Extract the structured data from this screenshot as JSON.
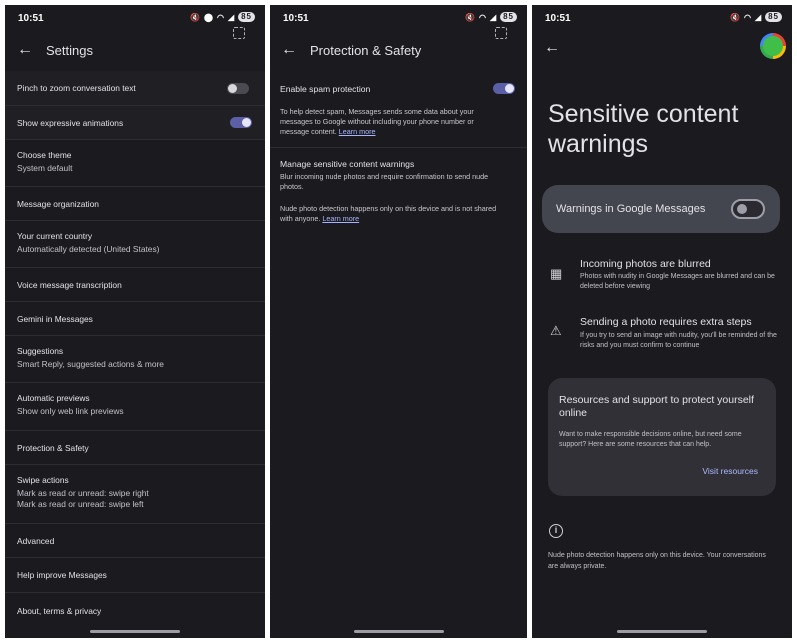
{
  "status": {
    "time": "10:51",
    "battery": "85"
  },
  "settings": {
    "title": "Settings",
    "items": [
      {
        "title": "Pinch to zoom conversation text",
        "toggle": "off"
      },
      {
        "title": "Show expressive animations",
        "toggle": "on"
      },
      {
        "title": "Choose theme",
        "subtitle": "System default"
      },
      {
        "title": "Message organization"
      },
      {
        "title": "Your current country",
        "subtitle": "Automatically detected (United States)"
      },
      {
        "title": "Voice message transcription"
      },
      {
        "title": "Gemini in Messages"
      },
      {
        "title": "Suggestions",
        "subtitle": "Smart Reply, suggested actions & more"
      },
      {
        "title": "Automatic previews",
        "subtitle": "Show only web link previews"
      },
      {
        "title": "Protection & Safety"
      },
      {
        "title": "Swipe actions",
        "subtitle": "Mark as read or unread: swipe right",
        "subtitle2": "Mark as read or unread: swipe left"
      },
      {
        "title": "Advanced"
      },
      {
        "title": "Help improve Messages"
      },
      {
        "title": "About, terms & privacy"
      }
    ]
  },
  "protection": {
    "title": "Protection & Safety",
    "spam_label": "Enable spam protection",
    "spam_toggle": "on",
    "spam_desc": "To help detect spam, Messages sends some data about your messages to Google without including your phone number or message content.",
    "learn_more": "Learn more",
    "sensitive_title": "Manage sensitive content warnings",
    "sensitive_desc": "Blur incoming nude photos and require confirmation to send nude photos.",
    "detect_note": "Nude photo detection happens only on this device and is not shared with anyone."
  },
  "sensitive": {
    "title": "Sensitive content warnings",
    "warnings_label": "Warnings in Google Messages",
    "warnings_toggle": "off",
    "features": [
      {
        "icon": "blur-icon",
        "title": "Incoming photos are blurred",
        "desc": "Photos with nudity in Google Messages are blurred and can be deleted before viewing"
      },
      {
        "icon": "warning-icon",
        "title": "Sending a photo requires extra steps",
        "desc": "If you try to send an image with nudity, you'll be reminded of the risks and you must confirm to continue"
      }
    ],
    "resources_title": "Resources and support to protect yourself online",
    "resources_desc": "Want to make responsible decisions online, but need some support? Here are some resources that can help.",
    "resources_button": "Visit resources",
    "footer_note": "Nude photo detection happens only on this device. Your conversations are always private."
  }
}
